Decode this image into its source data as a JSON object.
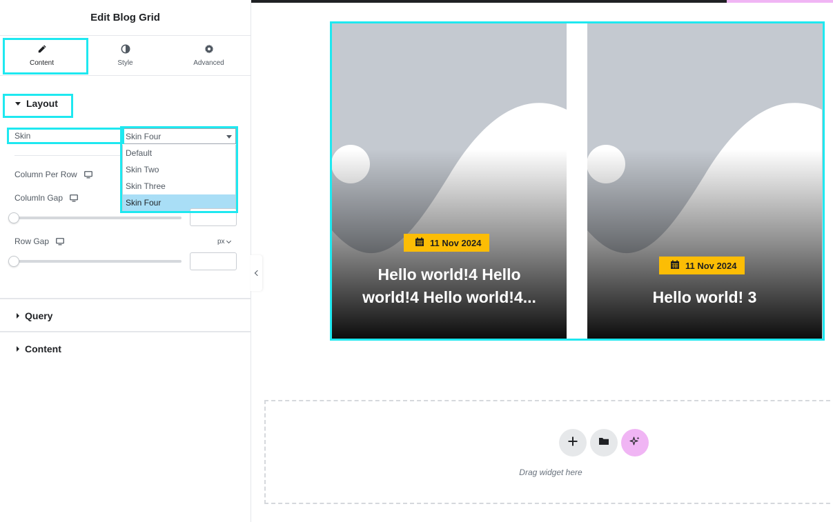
{
  "panel": {
    "title": "Edit Blog Grid",
    "tabs": [
      {
        "label": "Content",
        "icon": "pencil-icon"
      },
      {
        "label": "Style",
        "icon": "half-circle-icon"
      },
      {
        "label": "Advanced",
        "icon": "gear-icon"
      }
    ],
    "layout_section": {
      "title": "Layout",
      "skin": {
        "label": "Skin",
        "value": "Skin Four",
        "options": [
          "Default",
          "Skin Two",
          "Skin Three",
          "Skin Four"
        ]
      },
      "column_per_row": {
        "label": "Column Per Row"
      },
      "column_gap": {
        "label": "Columln Gap"
      },
      "row_gap": {
        "label": "Row Gap",
        "unit": "px"
      }
    },
    "query_section": {
      "title": "Query"
    },
    "content_section": {
      "title": "Content"
    }
  },
  "posts": [
    {
      "date": "11 Nov 2024",
      "title": "Hello world!4 Hello world!4 Hello world!4..."
    },
    {
      "date": "11 Nov 2024",
      "title": "Hello world! 3"
    }
  ],
  "dropzone": {
    "text": "Drag widget here",
    "buttons": [
      "plus-icon",
      "folder-icon",
      "sparkle-icon"
    ]
  },
  "colors": {
    "highlight": "#1ee8f0",
    "badge": "#fcbd05",
    "selected_option": "#a9def6",
    "ai_button": "#f0b5f4"
  }
}
